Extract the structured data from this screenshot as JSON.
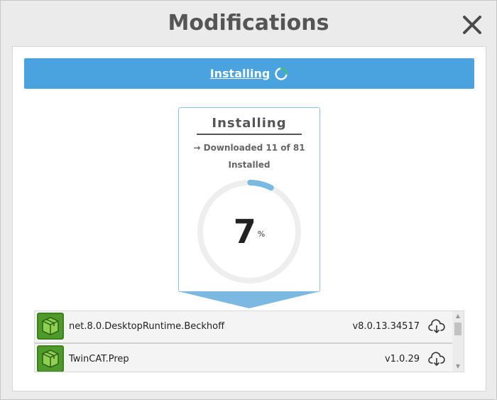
{
  "dialog": {
    "title": "Modifications",
    "close_icon": "close-icon"
  },
  "banner": {
    "label": "Installing",
    "icon": "spinner-icon",
    "color": "#4aa3df"
  },
  "status_card": {
    "title": "Installing",
    "download_line": "→ Downloaded 11 of 81",
    "installed_line": "Installed",
    "percent_value": "7",
    "percent_sign": "%",
    "progress_fraction": 0.07,
    "accent_color": "#7bb8e2"
  },
  "packages": [
    {
      "name": "net.8.0.DesktopRuntime.Beckhoff",
      "version": "v8.0.13.34517",
      "icon": "package-box-icon",
      "action_icon": "cloud-download-icon"
    },
    {
      "name": "TwinCAT.Prep",
      "version": "v1.0.29",
      "icon": "package-box-icon",
      "action_icon": "cloud-download-icon"
    }
  ],
  "scrollbar": {
    "up_glyph": "▲",
    "down_glyph": "▼"
  }
}
